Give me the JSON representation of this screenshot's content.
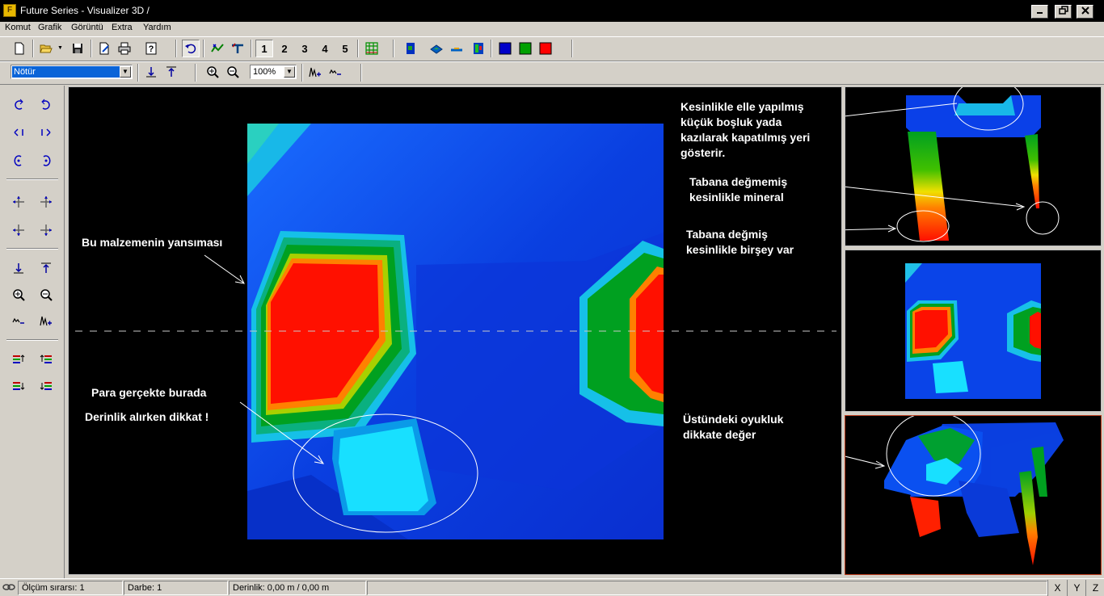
{
  "window": {
    "title": "Future Series - Visualizer 3D /",
    "icon": "app-logo-icon"
  },
  "menu": {
    "items": [
      "Komut",
      "Grafik",
      "Görüntü",
      "Extra",
      "Yardım"
    ]
  },
  "toolbar": {
    "view_numbers": [
      "1",
      "2",
      "3",
      "4",
      "5"
    ],
    "color_swatches": [
      "#0000c8",
      "#00a000",
      "#ff0000"
    ],
    "mode_select": "Nötür",
    "zoom_select": "100%"
  },
  "annotations": {
    "main_reflection": "Bu malzemenin yansıması",
    "main_money_line1": "Para gerçekte burada",
    "main_money_line2": "Derinlik alırken dikkat !",
    "side_hand_made": [
      "Kesinlikle elle yapılmış",
      "küçük boşluk yada",
      "kazılarak kapatılmış yeri",
      "gösterir."
    ],
    "side_not_touching": [
      "Tabana değmemiş",
      "kesinlikle mineral"
    ],
    "side_touching": [
      "Tabana değmiş",
      "kesinlikle birşey var"
    ],
    "side_cavity": [
      "Üstündeki oyukluk",
      "dikkate değer"
    ]
  },
  "status": {
    "measurement": "Ölçüm sırarsı: 1",
    "pulse": "Darbe: 1",
    "depth": "Derinlik: 0,00 m / 0,00 m",
    "axes": [
      "X",
      "Y",
      "Z"
    ]
  }
}
